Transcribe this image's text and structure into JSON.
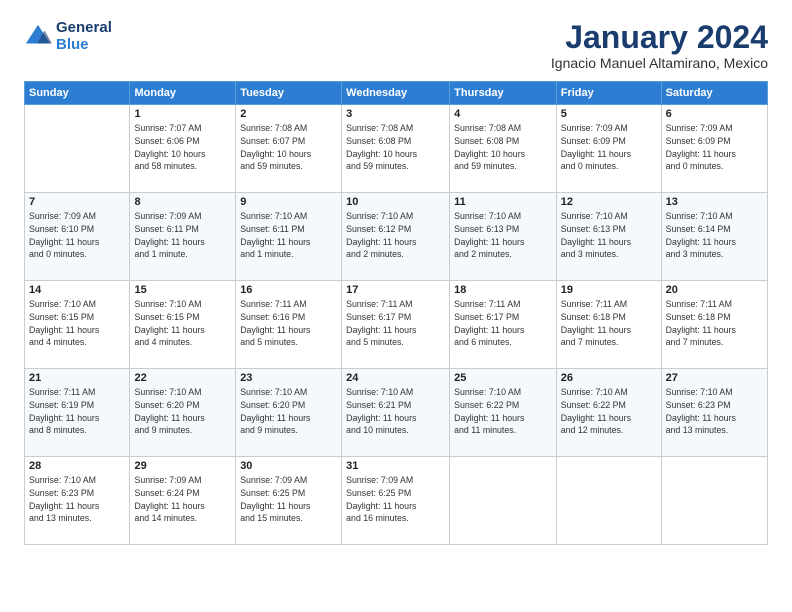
{
  "header": {
    "logo_line1": "General",
    "logo_line2": "Blue",
    "title": "January 2024",
    "subtitle": "Ignacio Manuel Altamirano, Mexico"
  },
  "calendar": {
    "headers": [
      "Sunday",
      "Monday",
      "Tuesday",
      "Wednesday",
      "Thursday",
      "Friday",
      "Saturday"
    ],
    "weeks": [
      [
        {
          "day": "",
          "info": ""
        },
        {
          "day": "1",
          "info": "Sunrise: 7:07 AM\nSunset: 6:06 PM\nDaylight: 10 hours\nand 58 minutes."
        },
        {
          "day": "2",
          "info": "Sunrise: 7:08 AM\nSunset: 6:07 PM\nDaylight: 10 hours\nand 59 minutes."
        },
        {
          "day": "3",
          "info": "Sunrise: 7:08 AM\nSunset: 6:08 PM\nDaylight: 10 hours\nand 59 minutes."
        },
        {
          "day": "4",
          "info": "Sunrise: 7:08 AM\nSunset: 6:08 PM\nDaylight: 10 hours\nand 59 minutes."
        },
        {
          "day": "5",
          "info": "Sunrise: 7:09 AM\nSunset: 6:09 PM\nDaylight: 11 hours\nand 0 minutes."
        },
        {
          "day": "6",
          "info": "Sunrise: 7:09 AM\nSunset: 6:09 PM\nDaylight: 11 hours\nand 0 minutes."
        }
      ],
      [
        {
          "day": "7",
          "info": "Sunrise: 7:09 AM\nSunset: 6:10 PM\nDaylight: 11 hours\nand 0 minutes."
        },
        {
          "day": "8",
          "info": "Sunrise: 7:09 AM\nSunset: 6:11 PM\nDaylight: 11 hours\nand 1 minute."
        },
        {
          "day": "9",
          "info": "Sunrise: 7:10 AM\nSunset: 6:11 PM\nDaylight: 11 hours\nand 1 minute."
        },
        {
          "day": "10",
          "info": "Sunrise: 7:10 AM\nSunset: 6:12 PM\nDaylight: 11 hours\nand 2 minutes."
        },
        {
          "day": "11",
          "info": "Sunrise: 7:10 AM\nSunset: 6:13 PM\nDaylight: 11 hours\nand 2 minutes."
        },
        {
          "day": "12",
          "info": "Sunrise: 7:10 AM\nSunset: 6:13 PM\nDaylight: 11 hours\nand 3 minutes."
        },
        {
          "day": "13",
          "info": "Sunrise: 7:10 AM\nSunset: 6:14 PM\nDaylight: 11 hours\nand 3 minutes."
        }
      ],
      [
        {
          "day": "14",
          "info": "Sunrise: 7:10 AM\nSunset: 6:15 PM\nDaylight: 11 hours\nand 4 minutes."
        },
        {
          "day": "15",
          "info": "Sunrise: 7:10 AM\nSunset: 6:15 PM\nDaylight: 11 hours\nand 4 minutes."
        },
        {
          "day": "16",
          "info": "Sunrise: 7:11 AM\nSunset: 6:16 PM\nDaylight: 11 hours\nand 5 minutes."
        },
        {
          "day": "17",
          "info": "Sunrise: 7:11 AM\nSunset: 6:17 PM\nDaylight: 11 hours\nand 5 minutes."
        },
        {
          "day": "18",
          "info": "Sunrise: 7:11 AM\nSunset: 6:17 PM\nDaylight: 11 hours\nand 6 minutes."
        },
        {
          "day": "19",
          "info": "Sunrise: 7:11 AM\nSunset: 6:18 PM\nDaylight: 11 hours\nand 7 minutes."
        },
        {
          "day": "20",
          "info": "Sunrise: 7:11 AM\nSunset: 6:18 PM\nDaylight: 11 hours\nand 7 minutes."
        }
      ],
      [
        {
          "day": "21",
          "info": "Sunrise: 7:11 AM\nSunset: 6:19 PM\nDaylight: 11 hours\nand 8 minutes."
        },
        {
          "day": "22",
          "info": "Sunrise: 7:10 AM\nSunset: 6:20 PM\nDaylight: 11 hours\nand 9 minutes."
        },
        {
          "day": "23",
          "info": "Sunrise: 7:10 AM\nSunset: 6:20 PM\nDaylight: 11 hours\nand 9 minutes."
        },
        {
          "day": "24",
          "info": "Sunrise: 7:10 AM\nSunset: 6:21 PM\nDaylight: 11 hours\nand 10 minutes."
        },
        {
          "day": "25",
          "info": "Sunrise: 7:10 AM\nSunset: 6:22 PM\nDaylight: 11 hours\nand 11 minutes."
        },
        {
          "day": "26",
          "info": "Sunrise: 7:10 AM\nSunset: 6:22 PM\nDaylight: 11 hours\nand 12 minutes."
        },
        {
          "day": "27",
          "info": "Sunrise: 7:10 AM\nSunset: 6:23 PM\nDaylight: 11 hours\nand 13 minutes."
        }
      ],
      [
        {
          "day": "28",
          "info": "Sunrise: 7:10 AM\nSunset: 6:23 PM\nDaylight: 11 hours\nand 13 minutes."
        },
        {
          "day": "29",
          "info": "Sunrise: 7:09 AM\nSunset: 6:24 PM\nDaylight: 11 hours\nand 14 minutes."
        },
        {
          "day": "30",
          "info": "Sunrise: 7:09 AM\nSunset: 6:25 PM\nDaylight: 11 hours\nand 15 minutes."
        },
        {
          "day": "31",
          "info": "Sunrise: 7:09 AM\nSunset: 6:25 PM\nDaylight: 11 hours\nand 16 minutes."
        },
        {
          "day": "",
          "info": ""
        },
        {
          "day": "",
          "info": ""
        },
        {
          "day": "",
          "info": ""
        }
      ]
    ]
  }
}
